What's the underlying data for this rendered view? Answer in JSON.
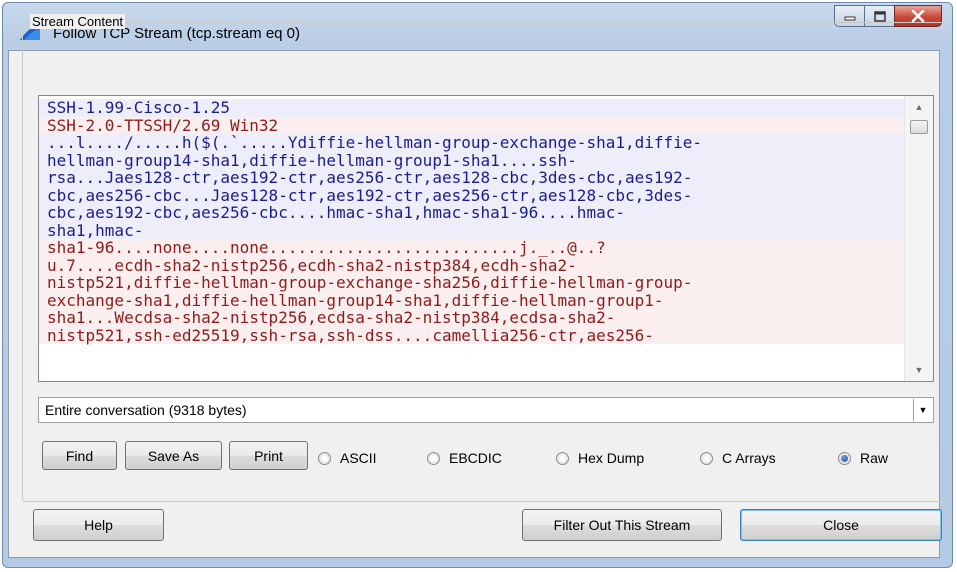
{
  "window": {
    "title": "Follow TCP Stream (tcp.stream eq 0)"
  },
  "groupbox_label": "Stream Content",
  "stream_lines": [
    {
      "text": "SSH-1.99-Cisco-1.25",
      "side": "client"
    },
    {
      "text": "SSH-2.0-TTSSH/2.69 Win32",
      "side": "server"
    },
    {
      "text": "...l..../.....h($(.`.....Ydiffie-hellman-group-exchange-sha1,diffie-",
      "side": "client"
    },
    {
      "text": "hellman-group14-sha1,diffie-hellman-group1-sha1....ssh-",
      "side": "client"
    },
    {
      "text": "rsa...Jaes128-ctr,aes192-ctr,aes256-ctr,aes128-cbc,3des-cbc,aes192-",
      "side": "client"
    },
    {
      "text": "cbc,aes256-cbc...Jaes128-ctr,aes192-ctr,aes256-ctr,aes128-cbc,3des-",
      "side": "client"
    },
    {
      "text": "cbc,aes192-cbc,aes256-cbc....hmac-sha1,hmac-sha1-96....hmac-",
      "side": "client"
    },
    {
      "text": "sha1,hmac-",
      "side": "client"
    },
    {
      "text": "sha1-96....none....none..........................j._..@..?",
      "side": "server"
    },
    {
      "text": "u.7....ecdh-sha2-nistp256,ecdh-sha2-nistp384,ecdh-sha2-",
      "side": "server"
    },
    {
      "text": "nistp521,diffie-hellman-group-exchange-sha256,diffie-hellman-group-",
      "side": "server"
    },
    {
      "text": "exchange-sha1,diffie-hellman-group14-sha1,diffie-hellman-group1-",
      "side": "server"
    },
    {
      "text": "sha1...Wecdsa-sha2-nistp256,ecdsa-sha2-nistp384,ecdsa-sha2-",
      "side": "server"
    },
    {
      "text": "nistp521,ssh-ed25519,ssh-rsa,ssh-dss....camellia256-ctr,aes256-",
      "side": "server"
    }
  ],
  "conversation_select": "Entire conversation (9318 bytes)",
  "buttons": {
    "find": "Find",
    "save_as": "Save As",
    "print": "Print",
    "help": "Help",
    "filter_out": "Filter Out This Stream",
    "close": "Close"
  },
  "format_options": [
    {
      "label": "ASCII",
      "checked": false
    },
    {
      "label": "EBCDIC",
      "checked": false
    },
    {
      "label": "Hex Dump",
      "checked": false
    },
    {
      "label": "C Arrays",
      "checked": false
    },
    {
      "label": "Raw",
      "checked": true
    }
  ],
  "colors": {
    "client_fg": "#1c1c8c",
    "client_bg": "#eeeefb",
    "server_fg": "#8c1c1c",
    "server_bg": "#fbeeee"
  },
  "icons": {
    "app": "wireshark-fin-icon",
    "minimize": "minimize-icon",
    "maximize": "maximize-icon",
    "close": "close-icon"
  }
}
